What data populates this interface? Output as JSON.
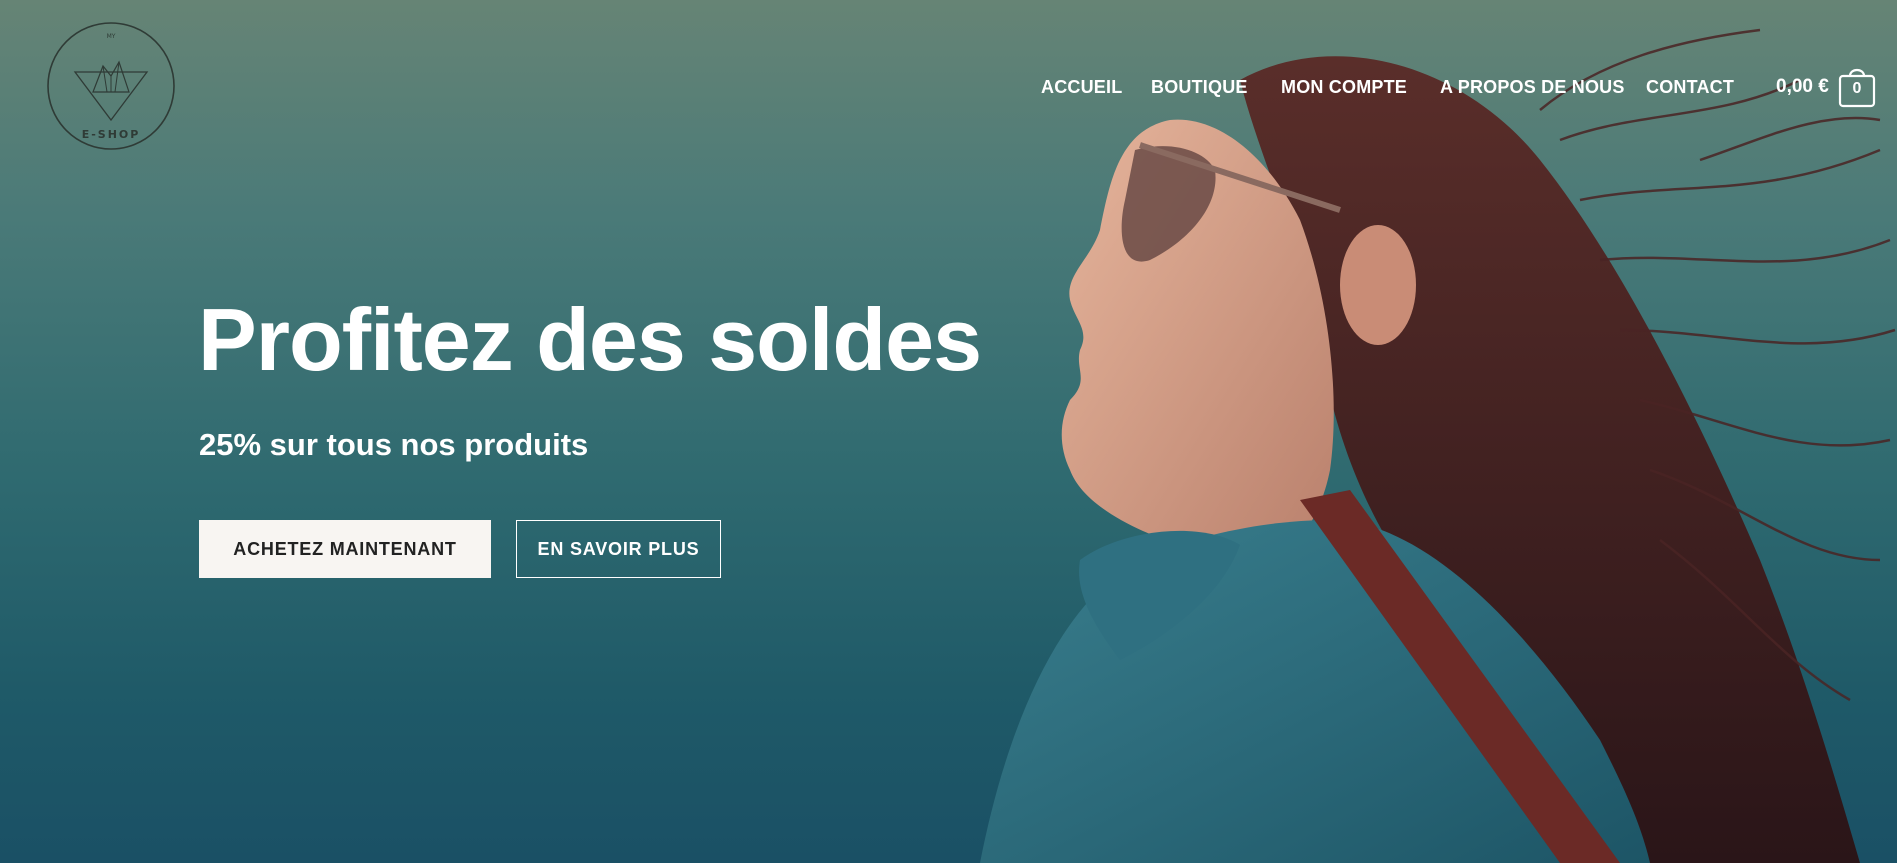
{
  "logo": {
    "top_text": "MY",
    "bottom_text": "E-SHOP"
  },
  "nav": {
    "items": [
      {
        "label": "ACCUEIL"
      },
      {
        "label": "BOUTIQUE"
      },
      {
        "label": "MON COMPTE"
      },
      {
        "label": "A PROPOS DE NOUS"
      },
      {
        "label": "CONTACT"
      }
    ]
  },
  "cart": {
    "total": "0,00 €",
    "count": "0"
  },
  "hero": {
    "headline": "Profitez des soldes",
    "subline": "25% sur tous nos produits",
    "primary_button": "ACHETEZ MAINTENANT",
    "secondary_button": "EN SAVOIR PLUS"
  },
  "colors": {
    "background_top": "#668475",
    "background_bottom": "#1a5065",
    "text": "#ffffff",
    "primary_button_bg": "#f8f5f2"
  }
}
